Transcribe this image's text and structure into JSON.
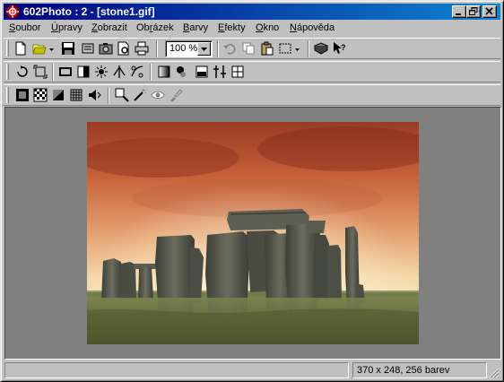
{
  "window": {
    "title": "602Photo : 2 - [stone1.gif]"
  },
  "menubar": {
    "items": [
      {
        "pre": "",
        "ul": "S",
        "post": "oubor"
      },
      {
        "pre": "",
        "ul": "Ú",
        "post": "pravy"
      },
      {
        "pre": "",
        "ul": "Z",
        "post": "obrazit"
      },
      {
        "pre": "Ob",
        "ul": "r",
        "post": "ázek"
      },
      {
        "pre": "",
        "ul": "B",
        "post": "arvy"
      },
      {
        "pre": "",
        "ul": "E",
        "post": "fekty"
      },
      {
        "pre": "",
        "ul": "O",
        "post": "kno"
      },
      {
        "pre": "",
        "ul": "N",
        "post": "ápověda"
      }
    ]
  },
  "toolbar1": {
    "zoom_value": "100 %"
  },
  "statusbar": {
    "left": "",
    "info": "370 x 248, 256 barev"
  },
  "colors": {
    "titlebar_start": "#000080",
    "titlebar_end": "#1084d0",
    "workspace": "#808080"
  }
}
